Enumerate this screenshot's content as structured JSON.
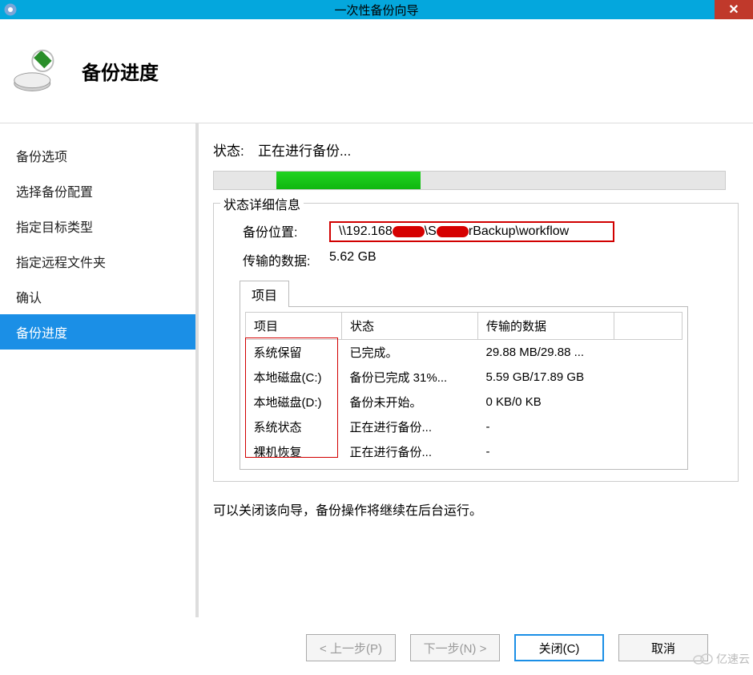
{
  "window": {
    "title": "一次性备份向导"
  },
  "header": {
    "title": "备份进度"
  },
  "sidebar": {
    "items": [
      {
        "label": "备份选项"
      },
      {
        "label": "选择备份配置"
      },
      {
        "label": "指定目标类型"
      },
      {
        "label": "指定远程文件夹"
      },
      {
        "label": "确认"
      },
      {
        "label": "备份进度"
      }
    ],
    "activeIndex": 5
  },
  "status": {
    "label": "状态:",
    "value": "正在进行备份...",
    "progressPercent": 28
  },
  "details": {
    "groupTitle": "状态详细信息",
    "locationLabel": "备份位置:",
    "locationPrefix": "\\\\192.168",
    "locationSuffix": "Backup\\workflow",
    "transferredLabel": "传输的数据:",
    "transferredValue": "5.62 GB"
  },
  "tab": {
    "label": "项目"
  },
  "table": {
    "columns": [
      "项目",
      "状态",
      "传输的数据"
    ],
    "rows": [
      {
        "item": "系统保留",
        "status": "已完成。",
        "data": "29.88 MB/29.88 ..."
      },
      {
        "item": "本地磁盘(C:)",
        "status": "备份已完成 31%...",
        "data": "5.59 GB/17.89 GB"
      },
      {
        "item": "本地磁盘(D:)",
        "status": "备份未开始。",
        "data": "0 KB/0 KB"
      },
      {
        "item": "系统状态",
        "status": "正在进行备份...",
        "data": "-"
      },
      {
        "item": "裸机恢复",
        "status": "正在进行备份...",
        "data": "-"
      }
    ]
  },
  "hint": "可以关闭该向导，备份操作将继续在后台运行。",
  "buttons": {
    "prev": "< 上一步(P)",
    "next": "下一步(N) >",
    "close": "关闭(C)",
    "cancel": "取消"
  },
  "watermark": "亿速云"
}
